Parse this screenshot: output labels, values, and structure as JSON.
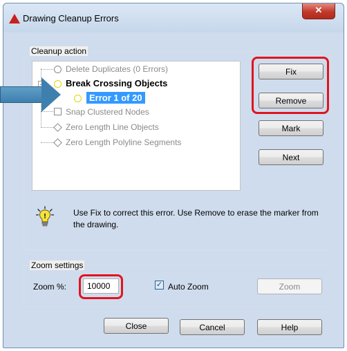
{
  "window": {
    "title": "Drawing Cleanup Errors",
    "close_glyph": "✕"
  },
  "cleanup": {
    "group_label": "Cleanup action",
    "tree": [
      {
        "label": "Delete Duplicates (0 Errors)",
        "icon": "circle-icon",
        "state": "disabled"
      },
      {
        "label": "Break Crossing Objects",
        "icon": "yellow-circle-icon",
        "state": "bold"
      },
      {
        "label": "Error 1 of 20",
        "icon": "yellow-circle-icon",
        "state": "selected"
      },
      {
        "label": "Snap Clustered Nodes",
        "icon": "square-icon",
        "state": "disabled"
      },
      {
        "label": "Zero Length Line Objects",
        "icon": "diamond-icon",
        "state": "disabled"
      },
      {
        "label": "Zero Length Polyline Segments",
        "icon": "diamond-icon",
        "state": "disabled"
      }
    ],
    "buttons": {
      "fix": "Fix",
      "remove": "Remove",
      "mark": "Mark",
      "next": "Next"
    },
    "info": "Use Fix to correct this error. Use Remove to erase the marker from the drawing."
  },
  "zoom": {
    "group_label": "Zoom settings",
    "zoom_label": "Zoom %:",
    "zoom_value": "10000",
    "auto_zoom_label": "Auto Zoom",
    "auto_zoom_checked": true,
    "zoom_button": "Zoom"
  },
  "footer": {
    "close": "Close",
    "cancel": "Cancel",
    "help": "Help"
  },
  "colors": {
    "highlight": "#e0141e",
    "selection": "#3399ff",
    "arrow": "#3f7fae"
  }
}
